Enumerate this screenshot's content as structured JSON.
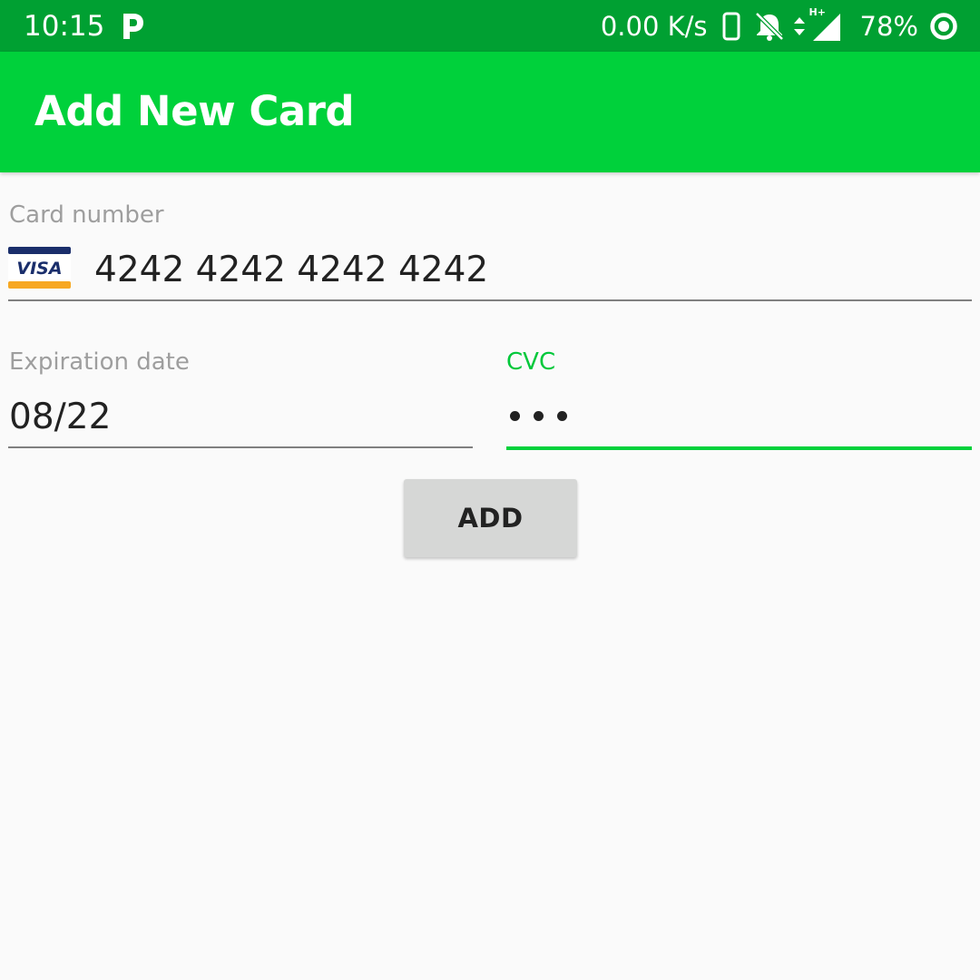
{
  "status_bar": {
    "time": "10:15",
    "speed": "0.00 K/s",
    "battery_percent": "78%",
    "icons": [
      "p-app-icon",
      "phone-icon",
      "bell-off-icon",
      "data-arrows-icon",
      "signal-icon",
      "battery-ring-icon"
    ],
    "network_type": "H+"
  },
  "app_bar": {
    "title": "Add New Card",
    "color": "#00d13b"
  },
  "form": {
    "card_number": {
      "label": "Card number",
      "value": "4242 4242 4242 4242",
      "brand": "VISA",
      "brand_icon": "visa-card-icon"
    },
    "expiration": {
      "label": "Expiration date",
      "value": "08/22"
    },
    "cvc": {
      "label": "CVC",
      "masked_length": 3,
      "focused": true
    },
    "add_button": {
      "label": "ADD"
    }
  },
  "colors": {
    "status_bar": "#00a032",
    "accent": "#00d13b",
    "label_gray": "#9e9e9e",
    "button_bg": "#d6d7d6"
  }
}
